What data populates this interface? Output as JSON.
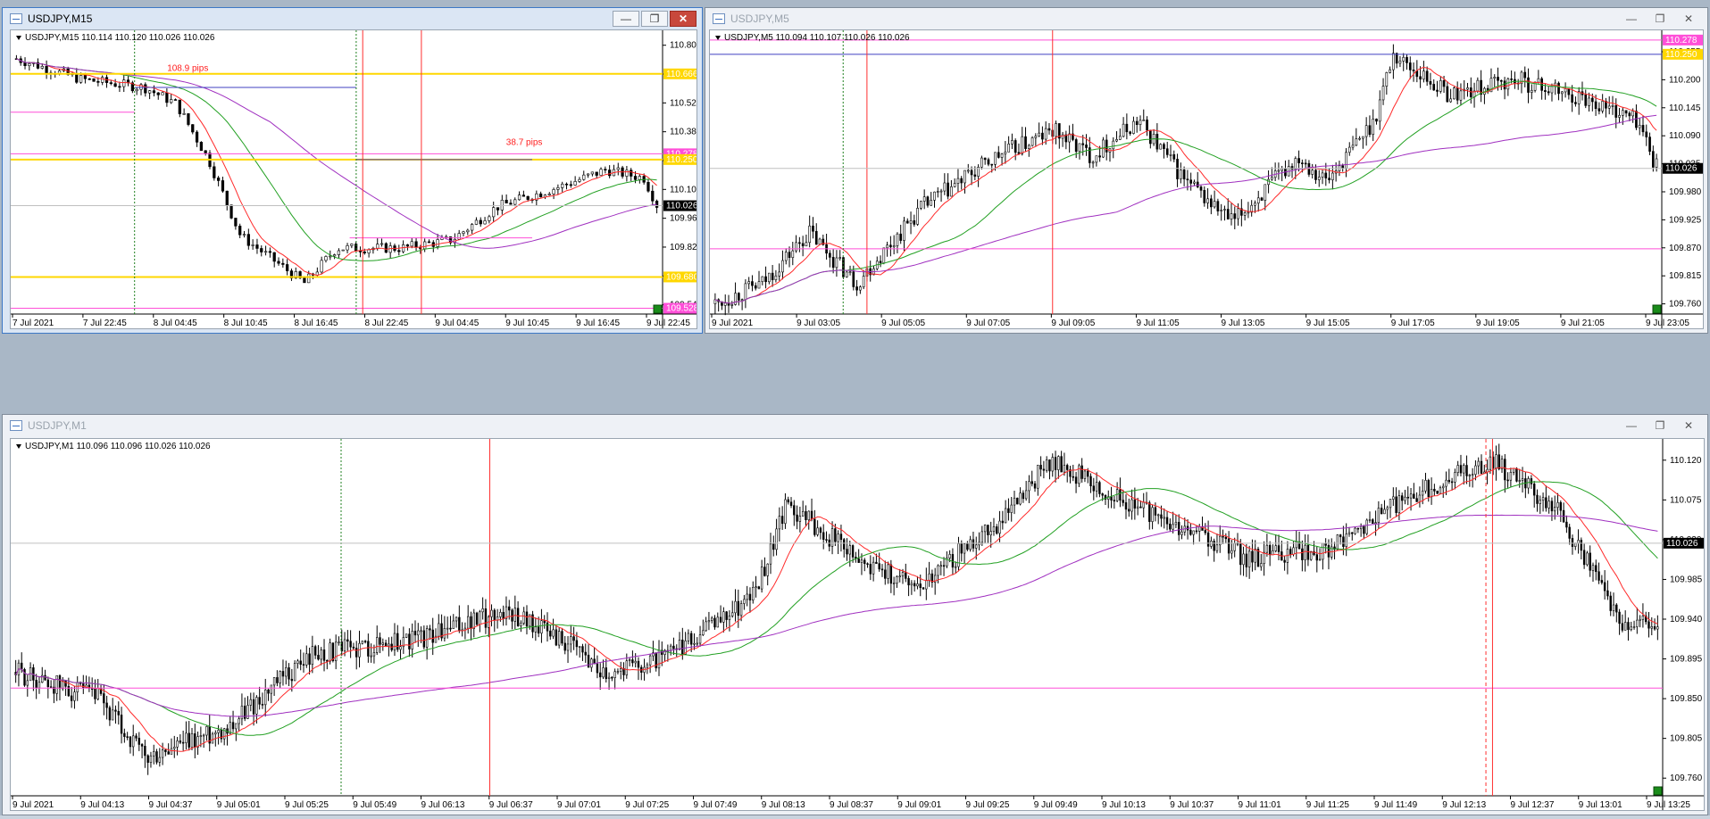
{
  "windows": {
    "m15": {
      "title": "USDJPY,M15",
      "info": "USDJPY,M15  110.114 110.120 110.026 110.026",
      "symbol": "USDJPY",
      "timeframe": "M15",
      "prices": [
        "110.805",
        "110.665",
        "110.525",
        "110.385",
        "110.245",
        "110.105",
        "109.965",
        "109.825",
        "109.685",
        "109.545"
      ],
      "times": [
        "7 Jul 2021",
        "7 Jul 22:45",
        "8 Jul 04:45",
        "8 Jul 10:45",
        "8 Jul 16:45",
        "8 Jul 22:45",
        "9 Jul 04:45",
        "9 Jul 10:45",
        "9 Jul 16:45",
        "9 Jul 22:45"
      ],
      "current_price": "110.026",
      "level_labels": [
        {
          "value": "110.666",
          "color": "#ffd700"
        },
        {
          "value": "110.278",
          "color": "#ff4fd8"
        },
        {
          "value": "110.250",
          "color": "#ffd700"
        },
        {
          "value": "109.680",
          "color": "#ffd700"
        },
        {
          "value": "109.528",
          "color": "#ff4fd8"
        }
      ],
      "annotations": [
        "108.9 pips",
        "38.7 pips"
      ]
    },
    "m5": {
      "title": "USDJPY,M5",
      "info": "USDJPY,M5  110.094 110.107 110.026 110.026",
      "symbol": "USDJPY",
      "timeframe": "M5",
      "prices": [
        "110.255",
        "110.200",
        "110.145",
        "110.090",
        "110.035",
        "109.980",
        "109.925",
        "109.870",
        "109.815",
        "109.760"
      ],
      "times": [
        "9 Jul 2021",
        "9 Jul 03:05",
        "9 Jul 05:05",
        "9 Jul 07:05",
        "9 Jul 09:05",
        "9 Jul 11:05",
        "9 Jul 13:05",
        "9 Jul 15:05",
        "9 Jul 17:05",
        "9 Jul 19:05",
        "9 Jul 21:05",
        "9 Jul 23:05"
      ],
      "current_price": "110.026",
      "level_labels": [
        {
          "value": "110.278",
          "color": "#ff4fd8"
        },
        {
          "value": "110.250",
          "color": "#ffd700"
        }
      ]
    },
    "m1": {
      "title": "USDJPY,M1",
      "info": "USDJPY,M1  110.096 110.096 110.026 110.026",
      "symbol": "USDJPY",
      "timeframe": "M1",
      "prices": [
        "110.120",
        "110.075",
        "110.030",
        "109.985",
        "109.940",
        "109.895",
        "109.850",
        "109.805",
        "109.760"
      ],
      "times": [
        "9 Jul 2021",
        "9 Jul 04:13",
        "9 Jul 04:37",
        "9 Jul 05:01",
        "9 Jul 05:25",
        "9 Jul 05:49",
        "9 Jul 06:13",
        "9 Jul 06:37",
        "9 Jul 07:01",
        "9 Jul 07:25",
        "9 Jul 07:49",
        "9 Jul 08:13",
        "9 Jul 08:37",
        "9 Jul 09:01",
        "9 Jul 09:25",
        "9 Jul 09:49",
        "9 Jul 10:13",
        "9 Jul 10:37",
        "9 Jul 11:01",
        "9 Jul 11:25",
        "9 Jul 11:49",
        "9 Jul 12:13",
        "9 Jul 12:37",
        "9 Jul 13:01",
        "9 Jul 13:25"
      ],
      "current_price": "110.026"
    }
  },
  "colors": {
    "candle": "#000000",
    "ma_fast": "#ff2a2a",
    "ma_mid": "#22a022",
    "ma_slow": "#a030c0",
    "level_yellow": "#ffd700",
    "level_magenta": "#ff4fd8",
    "vline_red": "#ff3030",
    "vline_green": "#208020",
    "hline_blue": "#4040c0",
    "price_tag_bg": "#000000",
    "pips_text": "#ff2020"
  },
  "window_buttons": {
    "minimize": "—",
    "restore": "❐",
    "close": "✕"
  }
}
